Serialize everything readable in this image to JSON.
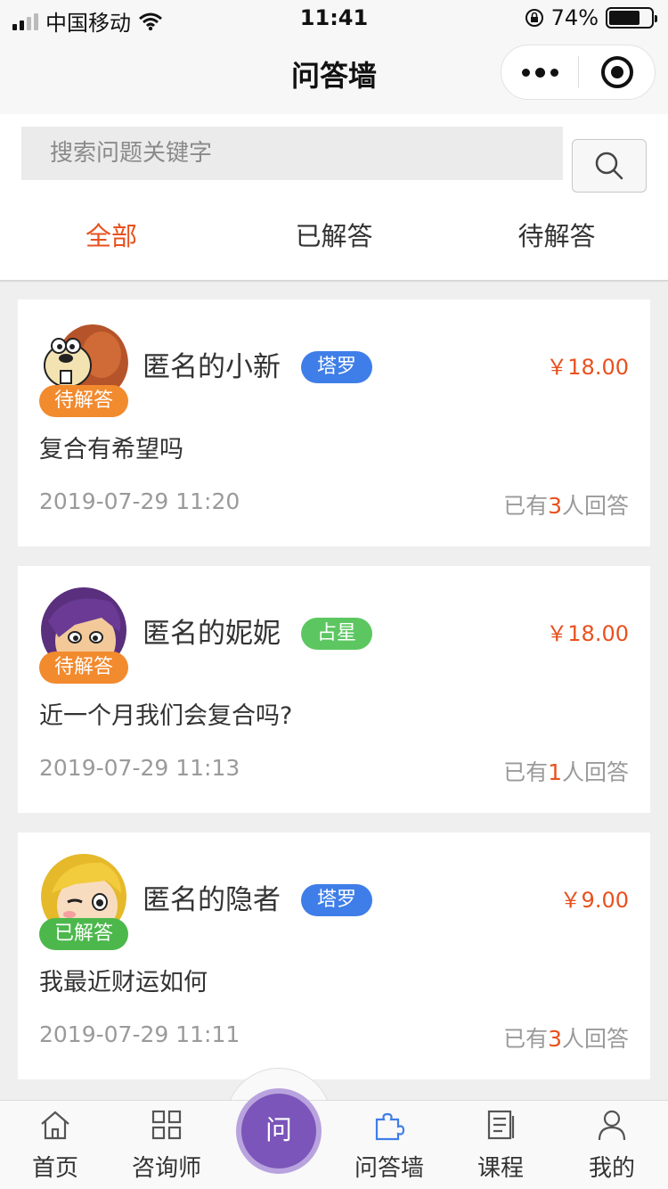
{
  "status_bar": {
    "carrier": "中国移动",
    "time": "11:41",
    "battery": "74%",
    "battery_level": 0.74
  },
  "nav": {
    "title": "问答墙"
  },
  "search": {
    "placeholder": "搜索问题关键字"
  },
  "tabs": [
    {
      "label": "全部",
      "active": true
    },
    {
      "label": "已解答",
      "active": false
    },
    {
      "label": "待解答",
      "active": false
    }
  ],
  "questions": [
    {
      "name": "匿名的小新",
      "status": "待解答",
      "status_color": "#f28a2e",
      "tag": "塔罗",
      "tag_color": "#3f7ee8",
      "price": "￥18.00",
      "question": "复合有希望吗",
      "time": "2019-07-29 11:20",
      "answers_prefix": "已有",
      "answers_count": "3",
      "answers_suffix": "人回答",
      "avatar": "beaver-avatar"
    },
    {
      "name": "匿名的妮妮",
      "status": "待解答",
      "status_color": "#f28a2e",
      "tag": "占星",
      "tag_color": "#5cc761",
      "price": "￥18.00",
      "question": "近一个月我们会复合吗?",
      "time": "2019-07-29 11:13",
      "answers_prefix": "已有",
      "answers_count": "1",
      "answers_suffix": "人回答",
      "avatar": "boy-avatar"
    },
    {
      "name": "匿名的隐者",
      "status": "已解答",
      "status_color": "#4cb84c",
      "tag": "塔罗",
      "tag_color": "#3f7ee8",
      "price": "￥9.00",
      "question": "我最近财运如何",
      "time": "2019-07-29 11:11",
      "answers_prefix": "已有",
      "answers_count": "3",
      "answers_suffix": "人回答",
      "avatar": "girl-avatar"
    }
  ],
  "tab_bar": {
    "items": [
      {
        "label": "首页",
        "icon": "home-icon"
      },
      {
        "label": "咨询师",
        "icon": "grid-icon"
      },
      {
        "label": "问答墙",
        "icon": "puzzle-icon"
      },
      {
        "label": "课程",
        "icon": "book-icon"
      },
      {
        "label": "我的",
        "icon": "user-icon"
      }
    ],
    "center_label": "问"
  }
}
